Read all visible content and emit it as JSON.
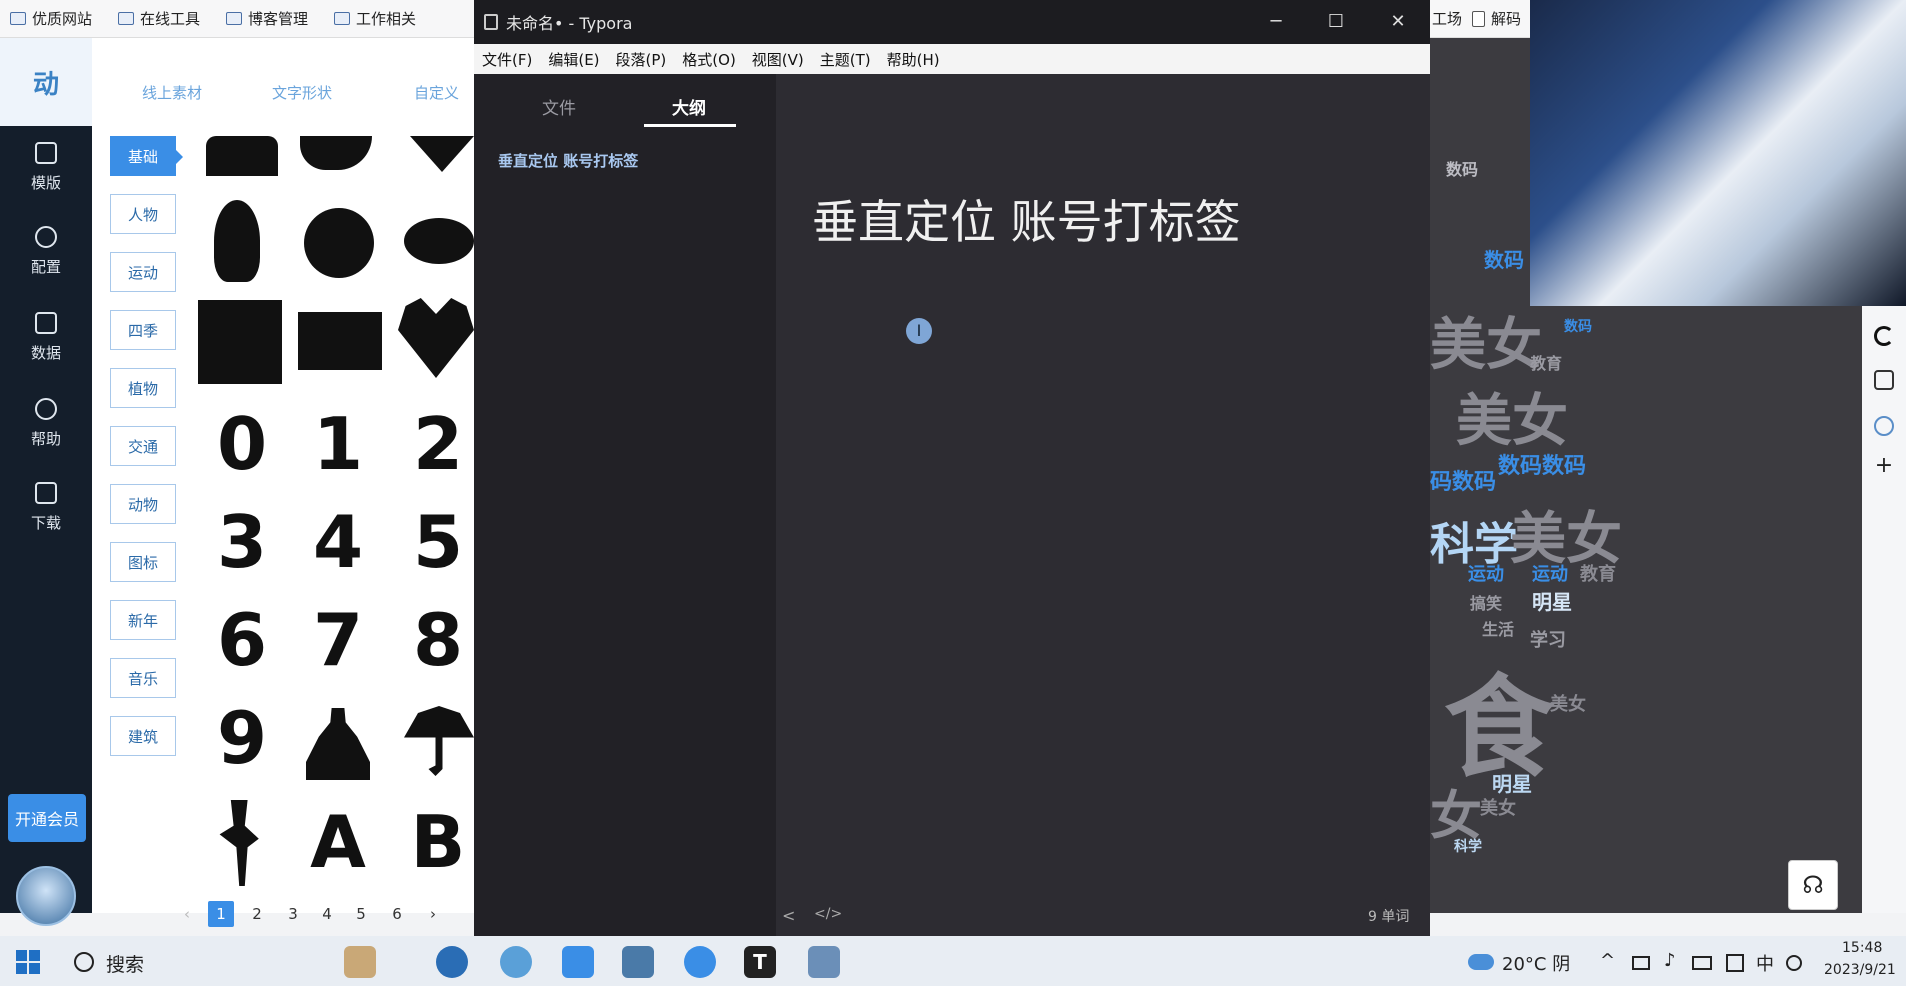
{
  "bookmarks": [
    {
      "label": "优质网站"
    },
    {
      "label": "在线工具"
    },
    {
      "label": "博客管理"
    },
    {
      "label": "工作相关"
    }
  ],
  "bookmarks_right": [
    {
      "label": "工场"
    },
    {
      "label": "解码"
    }
  ],
  "brand": {
    "text": "动"
  },
  "left_nav": [
    {
      "label": "模版",
      "icon": "template-icon"
    },
    {
      "label": "配置",
      "icon": "wrench-icon"
    },
    {
      "label": "数据",
      "icon": "inbox-icon"
    },
    {
      "label": "帮助",
      "icon": "info-icon"
    },
    {
      "label": "下载",
      "icon": "save-icon"
    }
  ],
  "vip_button": "开通会员",
  "material": {
    "tabs": [
      "线上素材",
      "文字形状",
      "自定义"
    ],
    "categories": [
      "基础",
      "人物",
      "运动",
      "四季",
      "植物",
      "交通",
      "动物",
      "图标",
      "新年",
      "音乐",
      "建筑"
    ],
    "active_category": "基础",
    "digit_shapes": [
      "0",
      "1",
      "2",
      "3",
      "4",
      "5",
      "6",
      "7",
      "8",
      "9"
    ],
    "letter_shapes": [
      "A",
      "B"
    ],
    "pagination": {
      "prev": "‹",
      "pages": [
        "1",
        "2",
        "3",
        "4",
        "5",
        "6"
      ],
      "next": "›",
      "active": "1"
    }
  },
  "typora": {
    "title": "未命名• - Typora",
    "menu": [
      "文件(F)",
      "编辑(E)",
      "段落(P)",
      "格式(O)",
      "视图(V)",
      "主题(T)",
      "帮助(H)"
    ],
    "sidebar_tabs": [
      "文件",
      "大纲"
    ],
    "active_sidebar_tab": "大纲",
    "outline": [
      "垂直定位 账号打标签"
    ],
    "heading": "垂直定位 账号打标签",
    "cursor_glyph": "I",
    "word_count": "9 单词",
    "footer_left": "<",
    "footer_code": "</>"
  },
  "wordcloud": [
    {
      "text": "数码",
      "color": "#bdbdc4"
    },
    {
      "text": "数码",
      "color": "#3a8ee6"
    },
    {
      "text": "美女",
      "color": "#8a8a92"
    },
    {
      "text": "数码",
      "color": "#3a8ee6"
    },
    {
      "text": "教育",
      "color": "#9a9aa2"
    },
    {
      "text": "美女",
      "color": "#8a8a92"
    },
    {
      "text": "数码数码",
      "color": "#3a8ee6"
    },
    {
      "text": "码数码",
      "color": "#3a8ee6"
    },
    {
      "text": "科学",
      "color": "#b4d6f5"
    },
    {
      "text": "美女",
      "color": "#8a8a92"
    },
    {
      "text": "运动",
      "color": "#3a8ee6"
    },
    {
      "text": "运动",
      "color": "#3a8ee6"
    },
    {
      "text": "教育",
      "color": "#8a8a92"
    },
    {
      "text": "明星",
      "color": "#d6e6f6"
    },
    {
      "text": "搞笑",
      "color": "#9a9aa2"
    },
    {
      "text": "生活",
      "color": "#9a9aa2"
    },
    {
      "text": "学习",
      "color": "#9a9aa2"
    },
    {
      "text": "食",
      "color": "#8a8a92"
    },
    {
      "text": "美女",
      "color": "#8a8a92"
    },
    {
      "text": "明星",
      "color": "#bcd8f2"
    },
    {
      "text": "女",
      "color": "#8a8a92"
    },
    {
      "text": "美女",
      "color": "#8a8a92"
    },
    {
      "text": "科学",
      "color": "#bcd8f2"
    }
  ],
  "taskbar": {
    "search_label": "搜索",
    "weather": "20°C 阴",
    "ime": "中",
    "time": "15:48",
    "date": "2023/9/21",
    "typora_letter": "T"
  }
}
